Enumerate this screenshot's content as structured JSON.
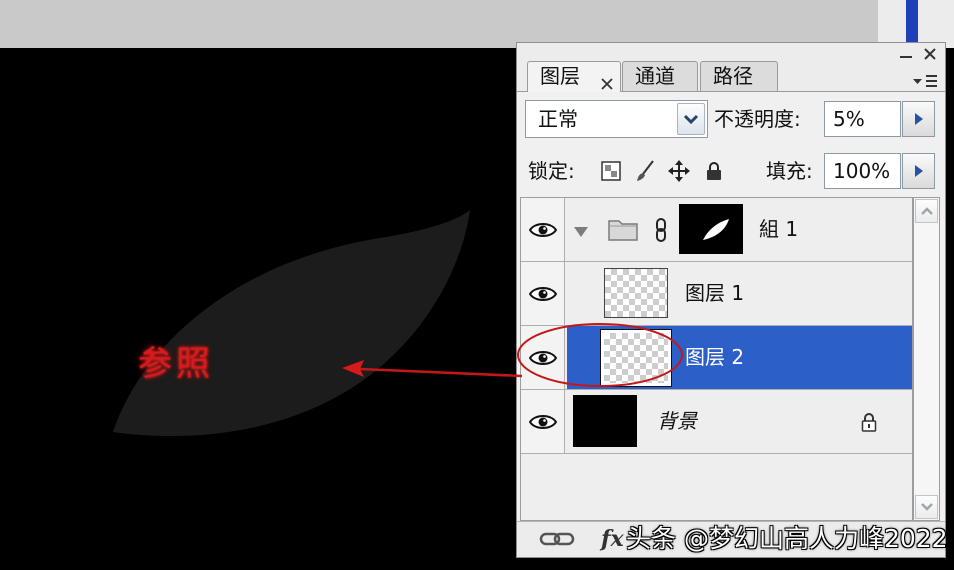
{
  "colors": {
    "canvas_bg": "#000000",
    "leaf": "#1c1c1c",
    "annotation_red": "#d81a1a",
    "workspace_grey": "#c9c9c9",
    "title_stripe_blue": "#1f3fb8",
    "panel_bg": "#ececec",
    "selected_row": "#2d5fc9",
    "arrow_button_blue": "#2a4fa8"
  },
  "canvas": {
    "annotation_label": "参照"
  },
  "panel": {
    "window_icons": [
      "minimize-icon",
      "close-icon"
    ],
    "tabs": [
      {
        "label": "图层",
        "active": true,
        "close_icon": "close-icon"
      },
      {
        "label": "通道",
        "active": false
      },
      {
        "label": "路径",
        "active": false
      }
    ],
    "menu_icon": "panel-menu-icon",
    "blend_mode": {
      "value": "正常",
      "icon": "chevron-down-icon"
    },
    "opacity": {
      "label": "不透明度:",
      "value": "5%"
    },
    "lock": {
      "label": "锁定:",
      "icons": [
        "lock-transparency-icon",
        "lock-pixels-icon",
        "lock-position-icon",
        "lock-all-icon"
      ]
    },
    "fill": {
      "label": "填充:",
      "value": "100%"
    },
    "layers": [
      {
        "name": "組 1",
        "visible": true,
        "group": true,
        "expanded": true,
        "selected": false
      },
      {
        "name": "图层 1",
        "visible": true,
        "selected": false
      },
      {
        "name": "图层 2",
        "visible": true,
        "selected": true
      },
      {
        "name": "背景",
        "visible": true,
        "locked": true,
        "selected": false
      }
    ],
    "footer": {
      "link_icon": "link-layers-icon",
      "fx_label": "fx"
    }
  },
  "watermark": "头条 @梦幻山高人力峰2022"
}
